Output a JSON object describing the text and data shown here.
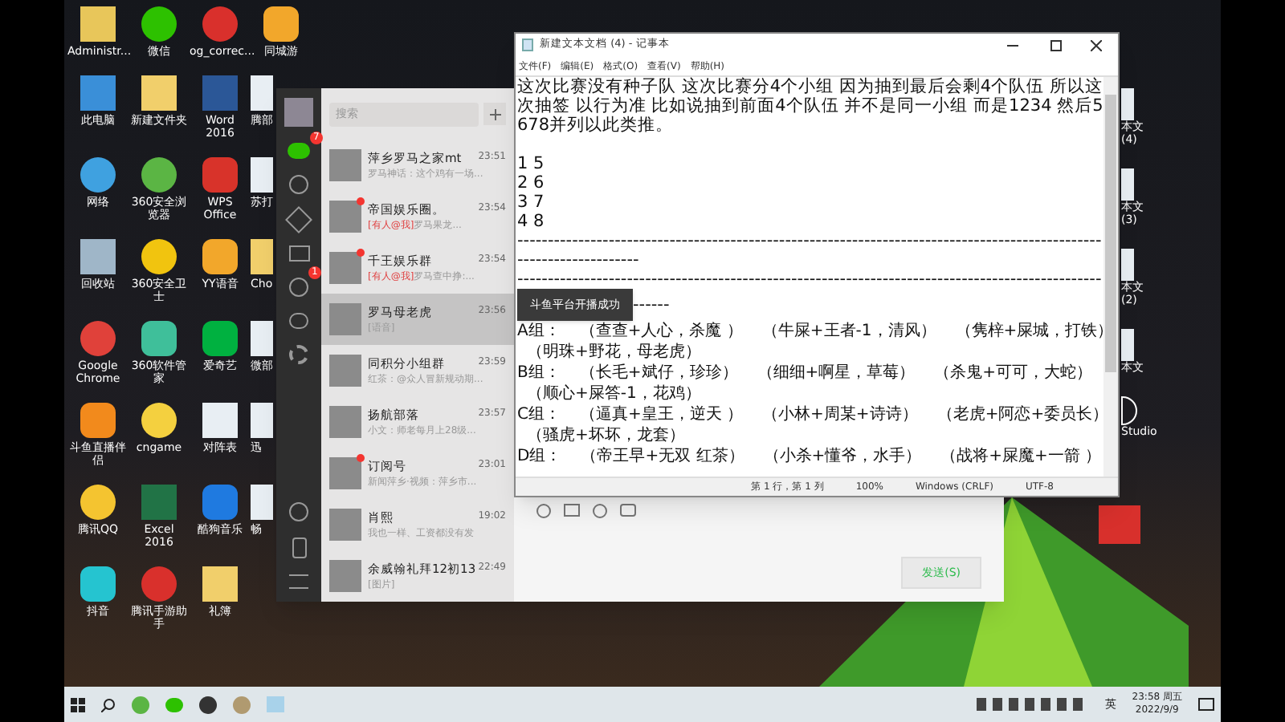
{
  "desktop_icons": [
    {
      "label": "Administr...",
      "kind": "user-folder"
    },
    {
      "label": "微信",
      "kind": "chat"
    },
    {
      "label": "og_correc...",
      "kind": "red-app"
    },
    {
      "label": "同城游",
      "kind": "cat"
    },
    {
      "label": "此电脑",
      "kind": "computer"
    },
    {
      "label": "新建文件夹",
      "kind": "folder"
    },
    {
      "label": "Word 2016",
      "kind": "word"
    },
    {
      "label": "腾部",
      "kind": "file"
    },
    {
      "label": "网络",
      "kind": "network"
    },
    {
      "label": "360安全浏览器",
      "kind": "browser"
    },
    {
      "label": "WPS Office",
      "kind": "wps"
    },
    {
      "label": "苏打",
      "kind": "file"
    },
    {
      "label": "回收站",
      "kind": "bin"
    },
    {
      "label": "360安全卫士",
      "kind": "shield"
    },
    {
      "label": "YY语音",
      "kind": "cat"
    },
    {
      "label": "Cho",
      "kind": "folder"
    },
    {
      "label": "Google Chrome",
      "kind": "chrome"
    },
    {
      "label": "360软件管家",
      "kind": "store"
    },
    {
      "label": "爱奇艺",
      "kind": "video"
    },
    {
      "label": "微部",
      "kind": "file"
    },
    {
      "label": "斗鱼直播伴侣",
      "kind": "stream"
    },
    {
      "label": "cngame",
      "kind": "game"
    },
    {
      "label": "对阵表",
      "kind": "file"
    },
    {
      "label": "迅",
      "kind": "file"
    },
    {
      "label": "腾讯QQ",
      "kind": "penguin"
    },
    {
      "label": "Excel 2016",
      "kind": "excel"
    },
    {
      "label": "酷狗音乐",
      "kind": "music"
    },
    {
      "label": "畅",
      "kind": "file"
    },
    {
      "label": "抖音",
      "kind": "tiktok"
    },
    {
      "label": "腾讯手游助手",
      "kind": "red-app"
    },
    {
      "label": "礼簿",
      "kind": "folder"
    }
  ],
  "right_icons": [
    {
      "label": "本文",
      "sub": "(4)"
    },
    {
      "label": "本文",
      "sub": "(3)"
    },
    {
      "label": "本文",
      "sub": "(2)"
    },
    {
      "label": "本文"
    }
  ],
  "right_app": {
    "label": "Studio"
  },
  "wechat": {
    "search": {
      "placeholder": "搜索"
    },
    "chat_badge": "7",
    "moments_badge": "1",
    "chats": [
      {
        "name": "萍乡罗马之家mt",
        "time": "23:51",
        "preview": "罗马神话：这个鸡有一场...",
        "unread": false,
        "selected": false
      },
      {
        "name": "帝国娱乐圈。",
        "time": "23:54",
        "mention": "[有人@我]",
        "preview": "罗马果龙...",
        "unread": true,
        "selected": false
      },
      {
        "name": "千王娱乐群",
        "time": "23:54",
        "mention": "[有人@我]",
        "preview": "罗马查中挣:...",
        "unread": true,
        "selected": false
      },
      {
        "name": "罗马母老虎",
        "time": "23:56",
        "preview": "[语音]",
        "unread": false,
        "selected": true
      },
      {
        "name": "同积分小组群",
        "time": "23:59",
        "preview": "红茶：@众人冒新规动期...",
        "unread": false,
        "selected": false
      },
      {
        "name": "扬航部落",
        "time": "23:57",
        "preview": "小文：师老每月上28级...",
        "unread": false,
        "selected": false
      },
      {
        "name": "订阅号",
        "time": "23:01",
        "preview": "新闻萍乡·视频：萍乡市...",
        "unread": true,
        "selected": false
      },
      {
        "name": "肖熙",
        "time": "19:02",
        "preview": "我也一样、工资都没有发",
        "unread": false,
        "selected": false
      },
      {
        "name": "余威翰礼拜12初13",
        "time": "22:49",
        "preview": "[图片]",
        "unread": false,
        "selected": false
      }
    ],
    "send_button": "发送(S)"
  },
  "notepad": {
    "title": "新建文本文档 (4) - 记事本",
    "menu": [
      "文件(F)",
      "编辑(E)",
      "格式(O)",
      "查看(V)",
      "帮助(H)"
    ],
    "lines": [
      {
        "kind": "text",
        "text": "这次比赛没有种子队  这次比赛分4个小组 因为抽到最后会剩4个队伍 所以这次抽签 以行为准 比如说抽到前面4个队伍 并不是同一小组 而是1234 然后5678并列以此类推。"
      },
      {
        "kind": "blank"
      },
      {
        "kind": "text",
        "text": "1 5"
      },
      {
        "kind": "text",
        "text": "2 6"
      },
      {
        "kind": "text",
        "text": "3 7"
      },
      {
        "kind": "text",
        "text": "4 8"
      },
      {
        "kind": "text",
        "text": "--------------------------------------------------------------------------------------------------------------------"
      },
      {
        "kind": "text",
        "text": "------------------------------------------------------------------------------------------------"
      },
      {
        "kind": "toast",
        "toast": "斗鱼平台开播成功",
        "text": "------"
      },
      {
        "kind": "group",
        "label": "A组：",
        "pairs": [
          "（查查+人心，杀魔 ）",
          "（牛屎+王者-1，清风）",
          "（隽梓+屎城，打铁）",
          "（明珠+野花，母老虎）"
        ]
      },
      {
        "kind": "group",
        "label": "B组：",
        "pairs": [
          "（长毛+斌仔，珍珍）",
          "（细细+啊星，草莓）",
          "（杀鬼+可可，大蛇）",
          "（顺心+屎答-1，花鸡）"
        ]
      },
      {
        "kind": "group",
        "label": "C组：",
        "pairs": [
          "（逼真+皇王，逆天 ）",
          "（小林+周某+诗诗）",
          "（老虎+阿恋+委员长）",
          "（骚虎+坏坏，龙套）"
        ]
      },
      {
        "kind": "group",
        "label": "D组：",
        "pairs": [
          "（帝王早+无双 红茶）",
          "（小杀+懂爷，水手）",
          "（战将+屎魔+一箭 ）"
        ]
      }
    ],
    "status": [
      "第 1 行，第 1 列",
      "100%",
      "Windows (CRLF)",
      "UTF-8"
    ]
  },
  "taskbar": {
    "input_method": "英",
    "time": "23:58 周五",
    "date": "2022/9/9"
  }
}
